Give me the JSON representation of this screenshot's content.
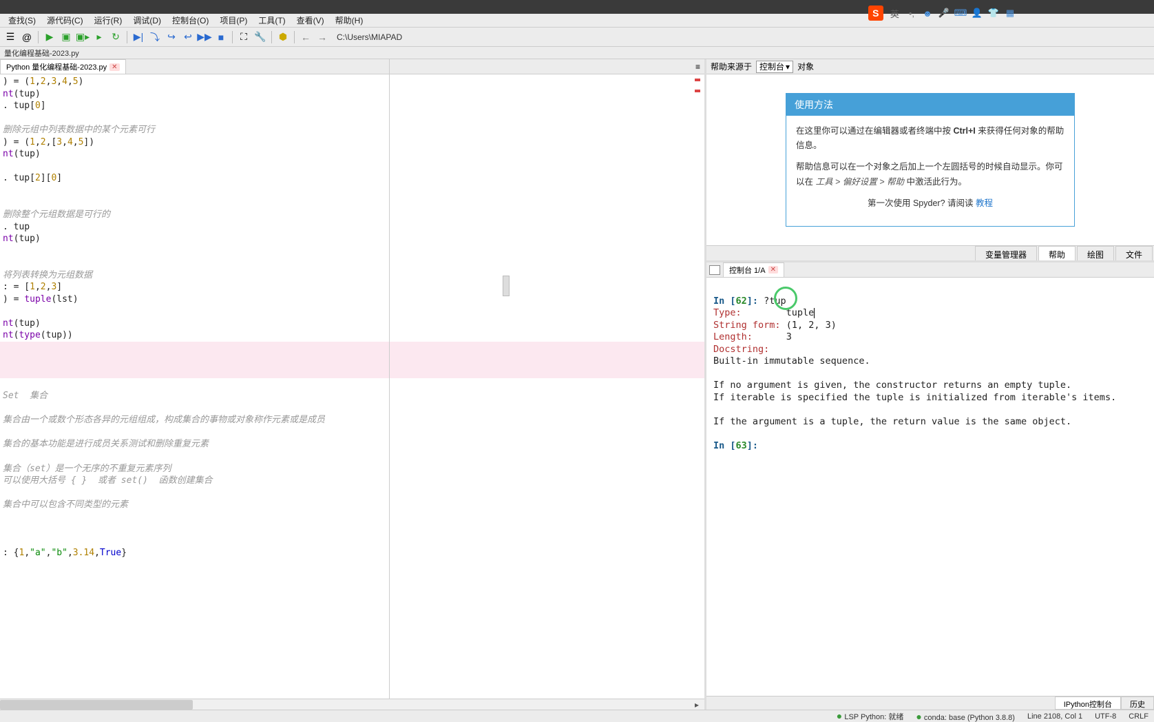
{
  "menubar": {
    "items": [
      "查找(S)",
      "源代码(C)",
      "运行(R)",
      "调试(D)",
      "控制台(O)",
      "项目(P)",
      "工具(T)",
      "查看(V)",
      "帮助(H)"
    ]
  },
  "toolbar": {
    "path": "C:\\Users\\MIAPAD"
  },
  "filepath": "量化编程基础-2023.py",
  "editor": {
    "tab_label": "Python 量化编程基础-2023.py",
    "code": ") = (1,2,3,4,5)\nnt(tup)\n. tup[0]\n\n删除元组中列表数据中的某个元素可行\n) = (1,2,[3,4,5])\nnt(tup)\n\n. tup[2][0]\n\n\n删除整个元组数据是可行的\n. tup\nnt(tup)\n\n\n将列表转换为元组数据\n: = [1,2,3]\n) = tuple(lst)\n\nnt(tup)\nnt(type(tup))\n\n\n\n\nSet  集合\n\n集合由一个或数个形态各异的元组组成，构成集合的事物或对象称作元素或是成员\n\n集合的基本功能是进行成员关系测试和删除重复元素\n\n集合（set）是一个无序的不重复元素序列\n可以使用大括号 { }  或者 set()  函数创建集合\n\n集合中可以包含不同类型的元素\n\n\n\n: {1,\"a\",\"b\",3.14,True}"
  },
  "help": {
    "source_label": "帮助来源于",
    "source_value": "控制台",
    "object_label": "对象",
    "card_title": "使用方法",
    "card_p1_a": "在这里你可以通过在编辑器或者终端中按 ",
    "card_p1_key": "Ctrl+I",
    "card_p1_b": " 来获得任何对象的帮助信息。",
    "card_p2_a": "帮助信息可以在一个对象之后加上一个左圆括号的时候自动显示。你可以在 ",
    "card_p2_i": "工具 > 偏好设置 > 帮助",
    "card_p2_b": " 中激活此行为。",
    "card_footer_a": "第一次使用 Spyder? 请阅读 ",
    "card_footer_link": "教程",
    "tabs": [
      "变量管理器",
      "帮助",
      "绘图",
      "文件"
    ]
  },
  "console": {
    "tab_label": "控制台 1/A",
    "content": {
      "in62_prompt": "In [62]: ",
      "in62_cmd": "?tup",
      "type_label": "Type:",
      "type_value": "tuple",
      "stringform_label": "String form:",
      "stringform_value": "(1, 2, 3)",
      "length_label": "Length:",
      "length_value": "3",
      "docstring_label": "Docstring:",
      "doc_l1": "Built-in immutable sequence.",
      "doc_l2": "If no argument is given, the constructor returns an empty tuple.",
      "doc_l3": "If iterable is specified the tuple is initialized from iterable's items.",
      "doc_l4": "If the argument is a tuple, the return value is the same object.",
      "in63_prompt": "In [63]: "
    },
    "bottom_tabs": [
      "IPython控制台",
      "历史"
    ]
  },
  "status": {
    "lsp": "LSP Python: 就绪",
    "conda": "conda: base (Python 3.8.8)",
    "pos": "Line 2108, Col 1",
    "enc": "UTF-8",
    "eol": "CRLF"
  },
  "overlay": {
    "s": "S",
    "lang": "英"
  }
}
